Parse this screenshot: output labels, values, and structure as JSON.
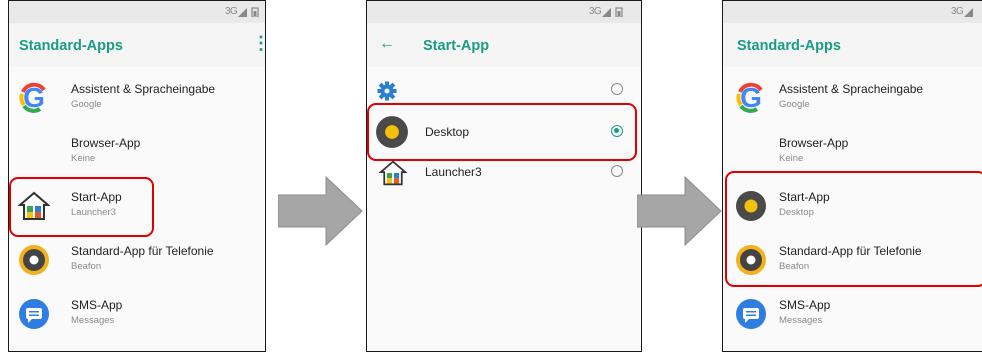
{
  "screen1": {
    "status": "3G",
    "title": "Standard-Apps",
    "menu_icon": "more-vert-icon",
    "items": [
      {
        "title": "Assistent & Spracheingabe",
        "subtitle": "Google",
        "icon": "google-icon"
      },
      {
        "title": "Browser-App",
        "subtitle": "Keine",
        "icon": ""
      },
      {
        "title": "Start-App",
        "subtitle": "Launcher3",
        "icon": "launcher3-icon"
      },
      {
        "title": "Standard-App für Telefonie",
        "subtitle": "Beafon",
        "icon": "beafon-icon"
      },
      {
        "title": "SMS-App",
        "subtitle": "Messages",
        "icon": "messages-icon"
      }
    ],
    "highlighted": "Start-App"
  },
  "screen2": {
    "status": "3G",
    "title": "Start-App",
    "back_icon": "arrow-back-icon",
    "options": [
      {
        "label": "",
        "icon": "settings-gear-icon",
        "selected": false
      },
      {
        "label": "Desktop",
        "icon": "desktop-launcher-icon",
        "selected": true
      },
      {
        "label": "Launcher3",
        "icon": "launcher3-icon",
        "selected": false
      }
    ],
    "highlighted": "Desktop"
  },
  "screen3": {
    "status": "3G",
    "title": "Standard-Apps",
    "menu_icon": "more-vert-icon",
    "items": [
      {
        "title": "Assistent & Spracheingabe",
        "subtitle": "Google",
        "icon": "google-icon"
      },
      {
        "title": "Browser-App",
        "subtitle": "Keine",
        "icon": ""
      },
      {
        "title": "Start-App",
        "subtitle": "Desktop",
        "icon": "desktop-launcher-icon"
      },
      {
        "title": "Standard-App für Telefonie",
        "subtitle": "Beafon",
        "icon": "beafon-icon"
      },
      {
        "title": "SMS-App",
        "subtitle": "Messages",
        "icon": "messages-icon"
      }
    ],
    "highlighted": [
      "Start-App",
      "Standard-App für Telefonie"
    ]
  },
  "colors": {
    "accent": "#1a9c86",
    "highlight": "#e00000",
    "arrow": "#a6a6a6"
  }
}
